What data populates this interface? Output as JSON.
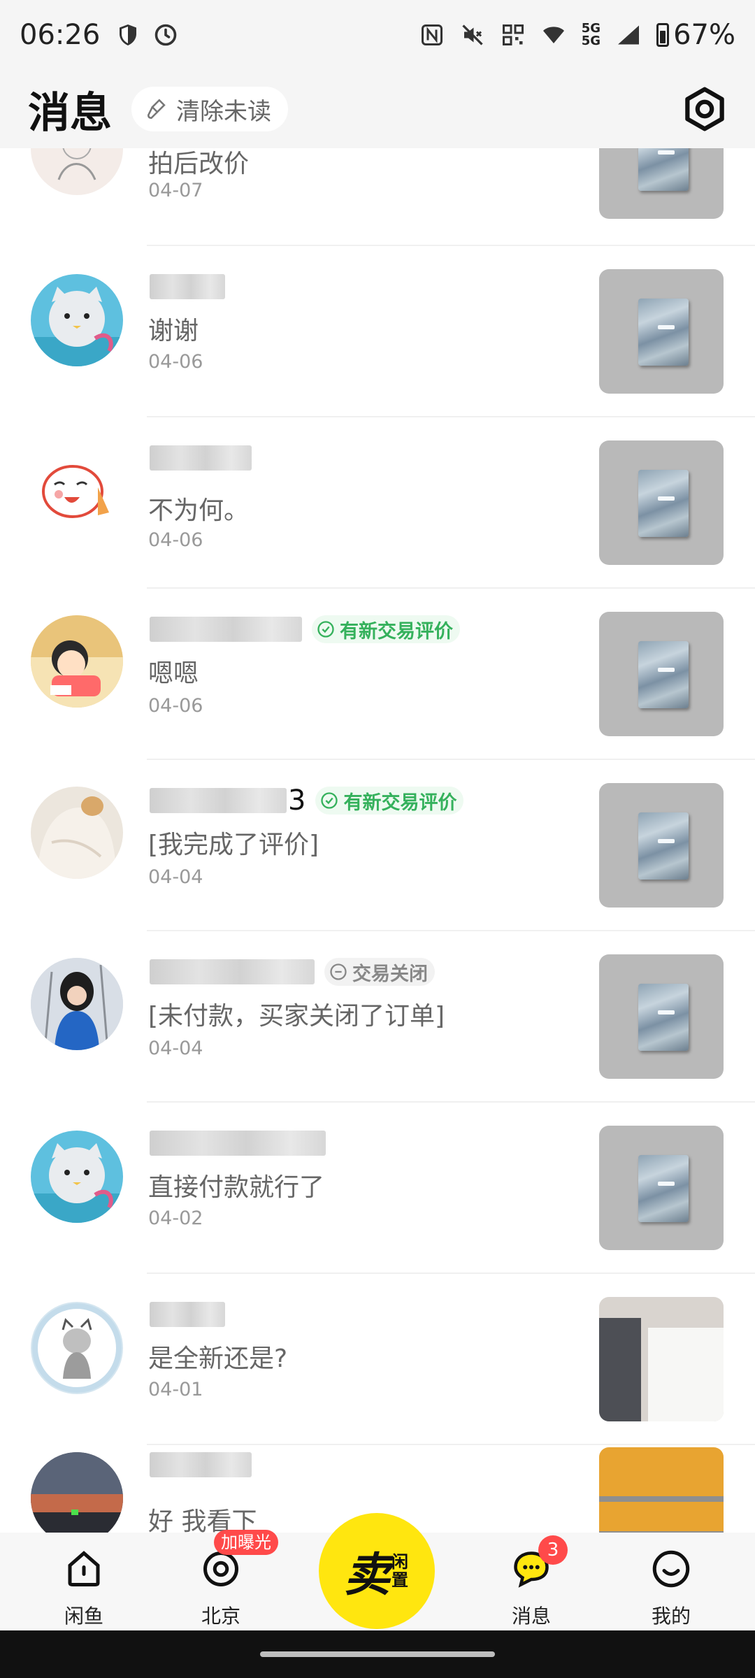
{
  "status_bar": {
    "time": "06:26",
    "battery_percent": "67%",
    "network": "5G",
    "network2": "5G"
  },
  "header": {
    "title": "消息",
    "clear_unread_label": "清除未读"
  },
  "conversations": [
    {
      "message": "拍后改价",
      "date": "04-07",
      "badge": "",
      "name_suffix": "",
      "avatar": "lady-sketch",
      "thumb": "card-box"
    },
    {
      "message": "谢谢",
      "date": "04-06",
      "badge": "",
      "name_suffix": "",
      "avatar": "fish-cat",
      "thumb": "card-box"
    },
    {
      "message": "不为何。",
      "date": "04-06",
      "badge": "",
      "name_suffix": "",
      "avatar": "cartoon-cat",
      "thumb": "card-box"
    },
    {
      "message": "嗯嗯",
      "date": "04-06",
      "badge": "有新交易评价",
      "name_suffix": "",
      "avatar": "cartoon-girl",
      "thumb": "card-box"
    },
    {
      "message": "[我完成了评价]",
      "date": "04-04",
      "badge": "有新交易评价",
      "name_suffix": "3",
      "avatar": "dog-blanket",
      "thumb": "card-box"
    },
    {
      "message": "[未付款，买家关闭了订单]",
      "date": "04-04",
      "badge": "交易关闭",
      "name_suffix": "",
      "avatar": "girl-photo",
      "thumb": "card-box"
    },
    {
      "message": "直接付款就行了",
      "date": "04-02",
      "badge": "",
      "name_suffix": "",
      "avatar": "fish-cat",
      "thumb": "card-box"
    },
    {
      "message": "是全新还是?",
      "date": "04-01",
      "badge": "",
      "name_suffix": "",
      "avatar": "cat-sketch",
      "thumb": "document"
    },
    {
      "message": "好 我看下",
      "date": "",
      "badge": "",
      "name_suffix": "",
      "avatar": "sunset",
      "thumb": "warehouse"
    }
  ],
  "bottom_nav": {
    "home_label": "闲鱼",
    "city_label": "北京",
    "city_promo": "加曝光",
    "sell_main": "卖",
    "sell_sub": "闲置",
    "messages_label": "消息",
    "messages_count": "3",
    "mine_label": "我的"
  },
  "colors": {
    "accent_yellow": "#ffe60f",
    "badge_green": "#35b15c",
    "badge_red": "#ff4a4a"
  }
}
